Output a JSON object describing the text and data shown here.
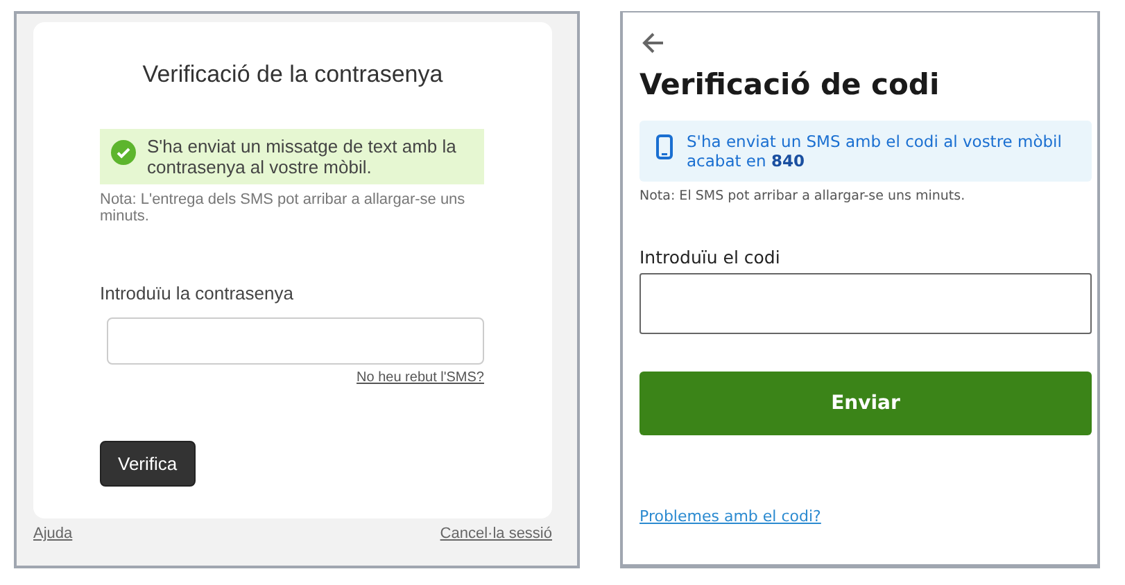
{
  "left_panel": {
    "title": "Verificació de la contrasenya",
    "alert": {
      "text": "S'ha enviat un missatge de text amb la contrasenya al vostre mòbil."
    },
    "note": "Nota: L'entrega dels SMS pot arribar a allargar-se uns minuts.",
    "field": {
      "label": "Introduïu la contrasenya"
    },
    "link": "No heu rebut l'SMS?",
    "button": "Verifica",
    "footer": {
      "help": "Ajuda",
      "logout": "Cancel·la sessió"
    }
  },
  "right_panel": {
    "title": "Verificació de codi",
    "info": "S'ha enviat un SMS amb el codi al vostre mòbil acabat en **840**",
    "note": "Nota: El SMS pot arribar a allargar-se uns minuts.",
    "field": {
      "label": "Introduïu el codi"
    },
    "button": "Enviar",
    "link": "Problemes amb el codi?"
  }
}
